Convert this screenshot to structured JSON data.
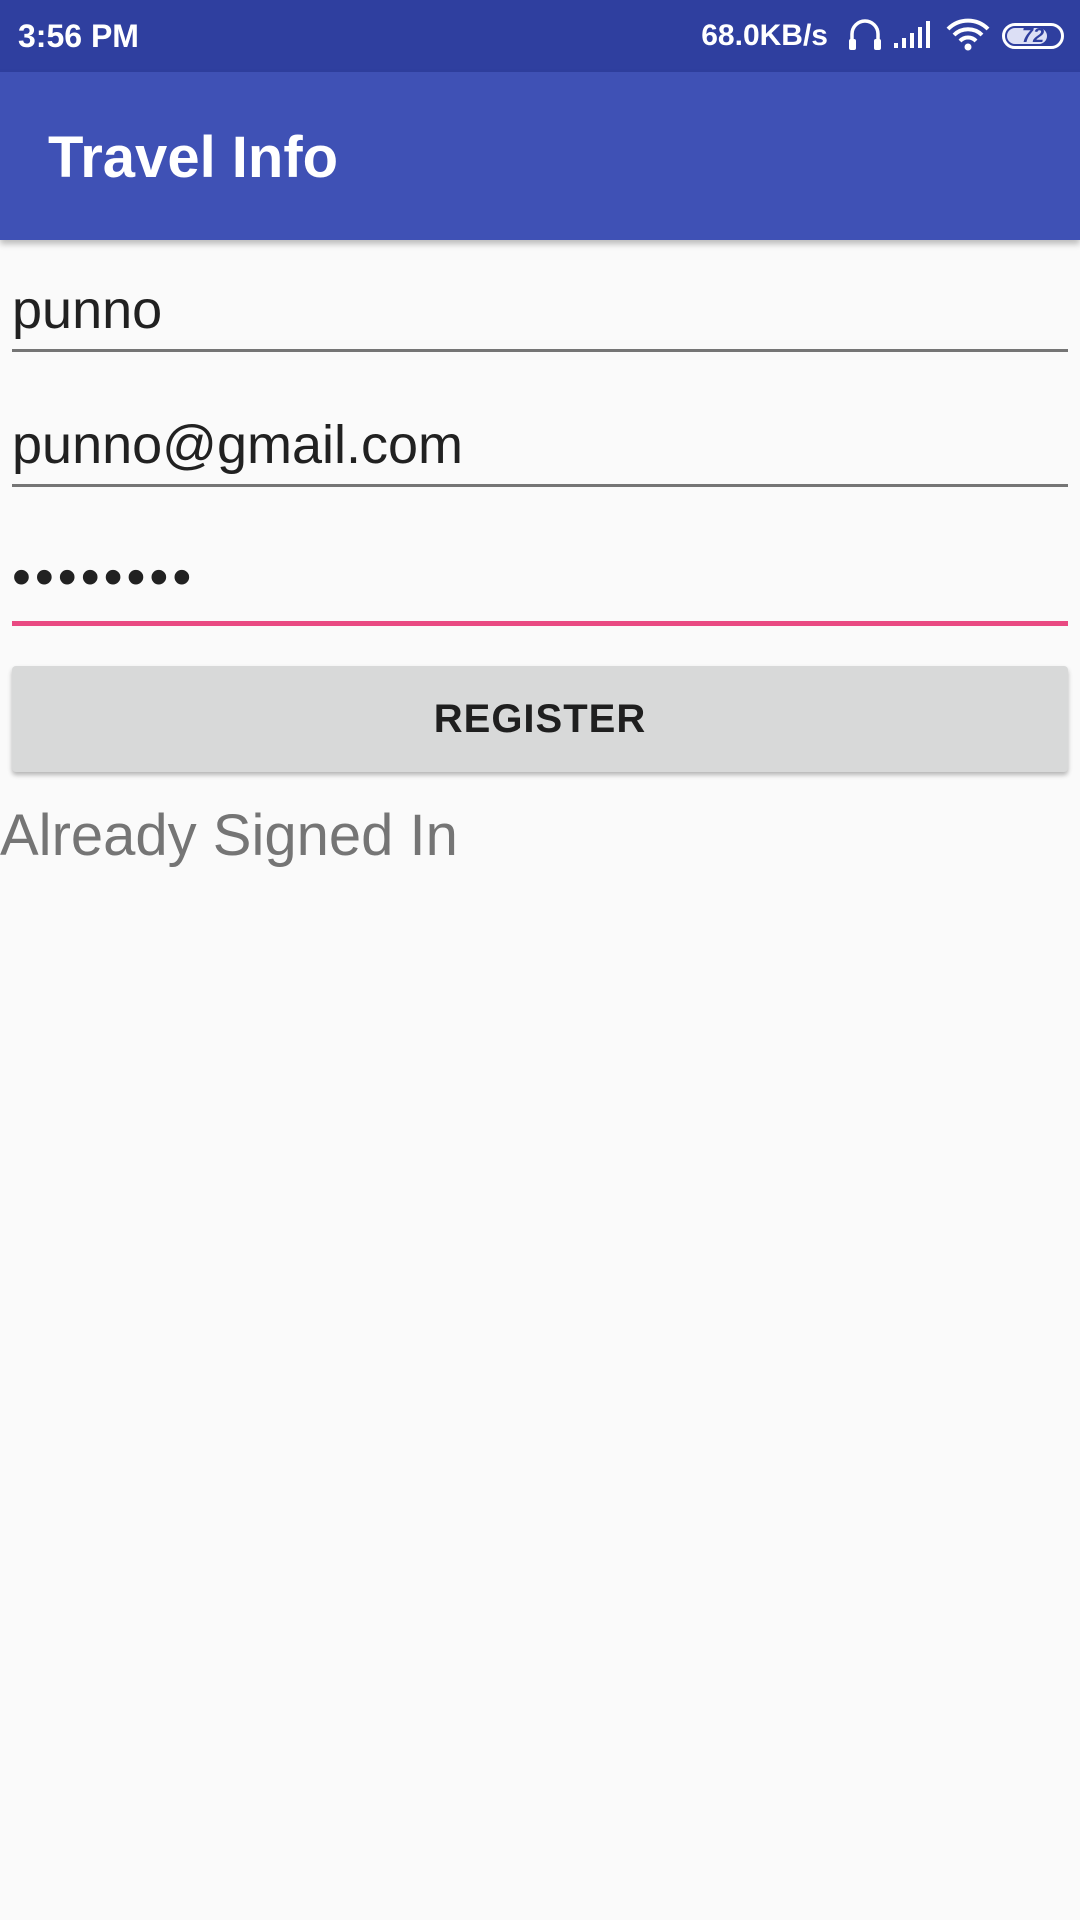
{
  "status_bar": {
    "time": "3:56 PM",
    "network_speed": "68.0KB/s",
    "battery_level": "72",
    "icons": [
      "headphones-icon",
      "cell-signal-icon",
      "wifi-icon",
      "battery-icon"
    ]
  },
  "app_bar": {
    "title": "Travel Info",
    "color": "#3f51b5"
  },
  "form": {
    "name_value": "punno",
    "email_value": "punno@gmail.com",
    "password_masked": "••••••••",
    "focus_color": "#e94a82"
  },
  "register_button": {
    "label": "REGISTER"
  },
  "already_signed_in": {
    "label": "Already Signed In"
  }
}
